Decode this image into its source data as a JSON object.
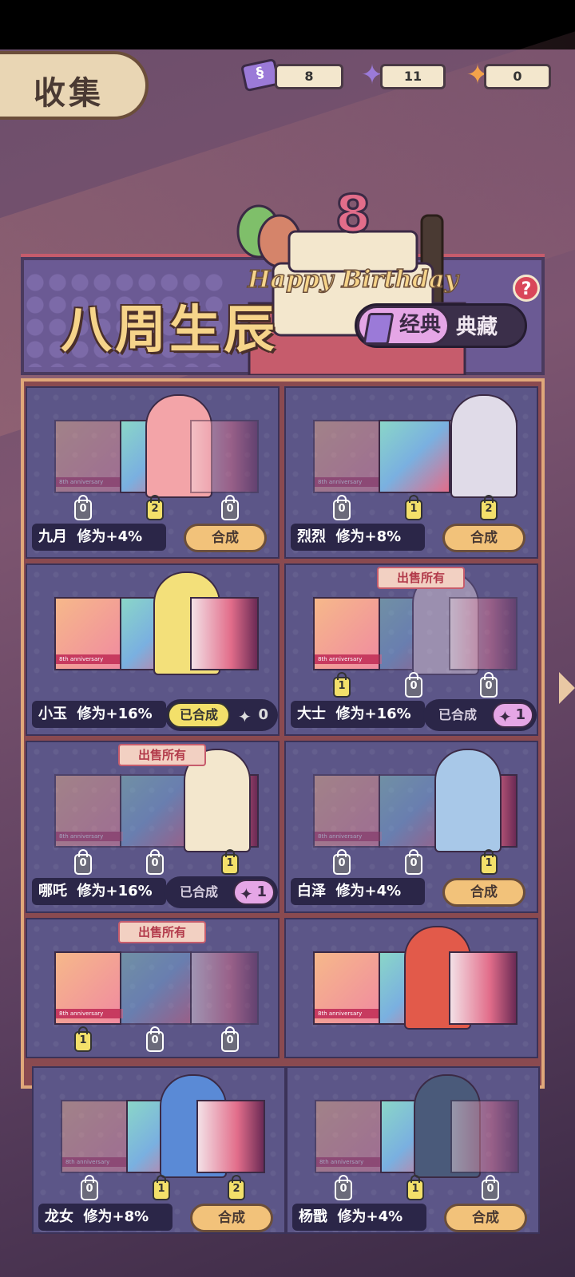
{
  "title": "收集",
  "resources": [
    {
      "icon": "ticket-icon",
      "value": "8"
    },
    {
      "icon": "puzzle-purple-icon",
      "value": "11"
    },
    {
      "icon": "puzzle-orange-icon",
      "value": "0"
    }
  ],
  "banner": {
    "title": "八周生辰",
    "tab_classic": "经典",
    "tab_collection": "典藏",
    "cake_number": "8",
    "cake_text": "Happy Birthday"
  },
  "strip_text": "8th anniversary",
  "cards": [
    {
      "name": "九月",
      "bonus": "修为+4%",
      "counts": [
        "0",
        "2",
        "0"
      ],
      "status": "compose",
      "button": "合成"
    },
    {
      "name": "烈烈",
      "bonus": "修为+8%",
      "counts": [
        "0",
        "1",
        "2"
      ],
      "status": "compose",
      "button": "合成"
    },
    {
      "name": "小玉",
      "bonus": "修为+16%",
      "counts": [],
      "status": "done",
      "done_label": "已合成",
      "piece_count": "0"
    },
    {
      "name": "大士",
      "bonus": "修为+16%",
      "counts": [
        "1",
        "0",
        "0"
      ],
      "status": "done",
      "done_label": "已合成",
      "piece_count": "1",
      "sell": "出售所有"
    },
    {
      "name": "哪吒",
      "bonus": "修为+16%",
      "counts": [
        "0",
        "0",
        "1"
      ],
      "status": "done",
      "done_label": "已合成",
      "piece_count": "1",
      "sell": "出售所有"
    },
    {
      "name": "白泽",
      "bonus": "修为+4%",
      "counts": [
        "0",
        "0",
        "1"
      ],
      "status": "compose",
      "button": "合成"
    },
    {
      "name": "",
      "bonus": "",
      "counts": [
        "1",
        "0",
        "0"
      ],
      "status": "none",
      "sell": "出售所有"
    },
    {
      "name": "",
      "bonus": "",
      "counts": [],
      "status": "none"
    },
    {
      "name": "龙女",
      "bonus": "修为+8%",
      "counts": [
        "0",
        "1",
        "2"
      ],
      "status": "compose",
      "button": "合成"
    },
    {
      "name": "杨戬",
      "bonus": "修为+4%",
      "counts": [
        "0",
        "1",
        "0"
      ],
      "status": "compose",
      "button": "合成"
    }
  ],
  "colors": {
    "accent_gold": "#f6d48a",
    "button": "#f2c27a",
    "done_highlight": "#f3e06a",
    "piece_pink": "#e5a6e6"
  }
}
